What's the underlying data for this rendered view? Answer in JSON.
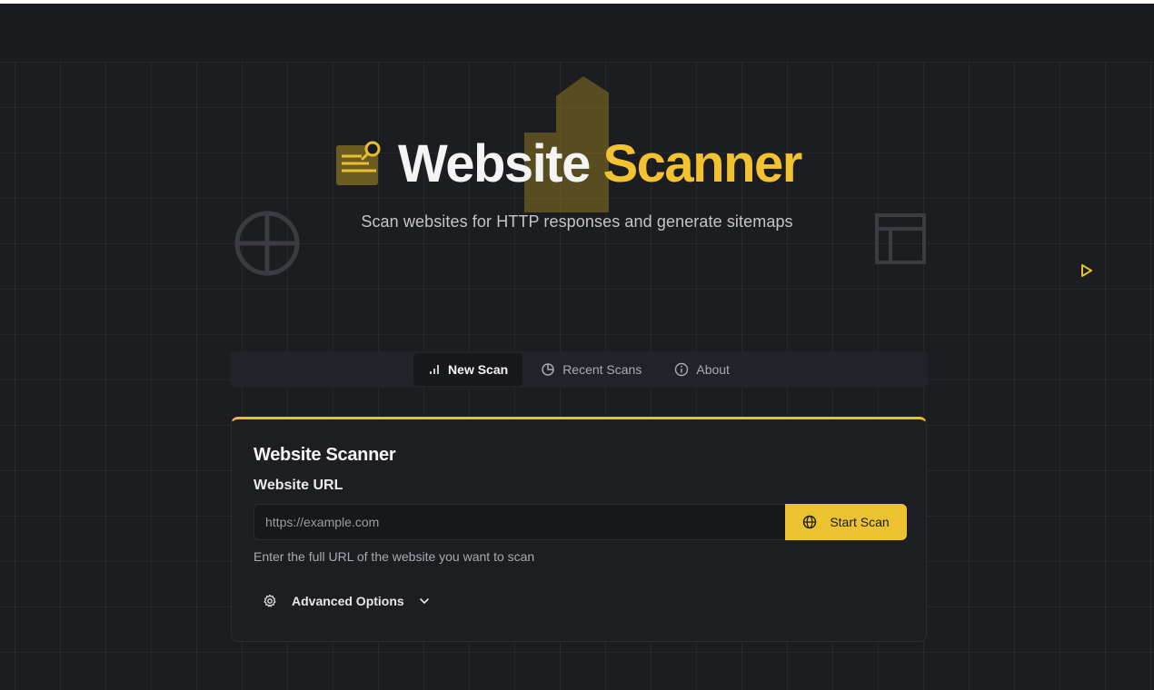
{
  "hero": {
    "title_word_1": "Website",
    "title_word_2": "Scanner",
    "subtitle": "Scan websites for HTTP responses and generate sitemaps",
    "logo_icon": "search-document-icon"
  },
  "tabs": [
    {
      "label": "New Scan",
      "icon": "bar-chart-icon",
      "active": true
    },
    {
      "label": "Recent Scans",
      "icon": "pie-chart-icon",
      "active": false
    },
    {
      "label": "About",
      "icon": "info-icon",
      "active": false
    }
  ],
  "scanner_card": {
    "title": "Website Scanner",
    "url_label": "Website URL",
    "url_value": "",
    "url_placeholder": "https://example.com",
    "start_button_label": "Start Scan",
    "start_button_icon": "globe-icon",
    "helper_text": "Enter the full URL of the website you want to scan",
    "advanced_options_label": "Advanced Options",
    "advanced_options_icon": "gear-icon",
    "advanced_options_expanded": false
  },
  "colors": {
    "accent": "#ebc22f",
    "background": "#1c1d21",
    "card": "#1d1e22",
    "text": "#f4f4f5",
    "muted_text": "#a9abb2"
  }
}
